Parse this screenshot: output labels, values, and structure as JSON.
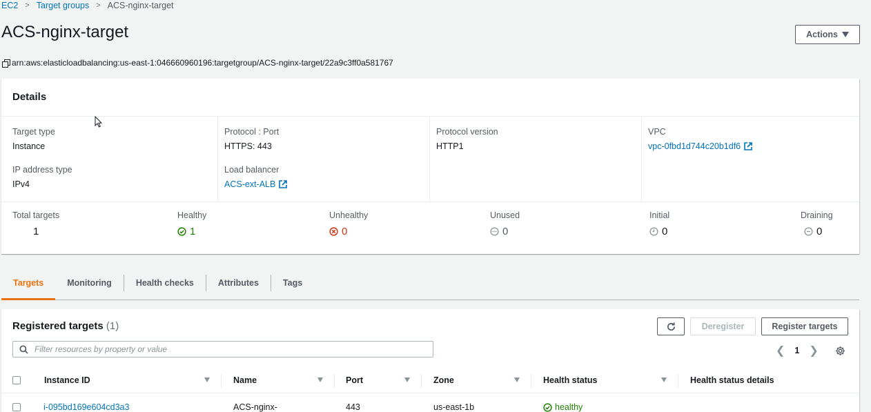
{
  "breadcrumb": {
    "items": [
      "EC2",
      "Target groups"
    ],
    "current": "ACS-nginx-target"
  },
  "page": {
    "title": "ACS-nginx-target",
    "actions_label": "Actions",
    "arn": "arn:aws:elasticloadbalancing:us-east-1:046660960196:targetgroup/ACS-nginx-target/22a9c3ff0a581767"
  },
  "details": {
    "header": "Details",
    "target_type": {
      "label": "Target type",
      "value": "Instance"
    },
    "protocol_port": {
      "label": "Protocol : Port",
      "value": "HTTPS: 443"
    },
    "protocol_version": {
      "label": "Protocol version",
      "value": "HTTP1"
    },
    "vpc": {
      "label": "VPC",
      "value": "vpc-0fbd1d744c20b1df6"
    },
    "ip_type": {
      "label": "IP address type",
      "value": "IPv4"
    },
    "load_balancer": {
      "label": "Load balancer",
      "value": "ACS-ext-ALB"
    },
    "stats": {
      "total": {
        "label": "Total targets",
        "value": "1"
      },
      "healthy": {
        "label": "Healthy",
        "value": "1"
      },
      "unhealthy": {
        "label": "Unhealthy",
        "value": "0"
      },
      "unused": {
        "label": "Unused",
        "value": "0"
      },
      "initial": {
        "label": "Initial",
        "value": "0"
      },
      "draining": {
        "label": "Draining",
        "value": "0"
      }
    }
  },
  "tabs": [
    "Targets",
    "Monitoring",
    "Health checks",
    "Attributes",
    "Tags"
  ],
  "registered": {
    "title": "Registered targets",
    "count": "(1)",
    "deregister_label": "Deregister",
    "register_label": "Register targets",
    "search_placeholder": "Filter resources by property or value",
    "page": "1",
    "columns": [
      "Instance ID",
      "Name",
      "Port",
      "Zone",
      "Health status",
      "Health status details"
    ],
    "rows": [
      {
        "instance_id": "i-095bd169e604cd3a3",
        "name": "ACS-nginx-",
        "port": "443",
        "zone": "us-east-1b",
        "health": "healthy",
        "details": ""
      }
    ]
  },
  "colors": {
    "link": "#0073bb",
    "healthy": "#1d8102",
    "unhealthy": "#d13212",
    "active_tab": "#ec7211"
  }
}
